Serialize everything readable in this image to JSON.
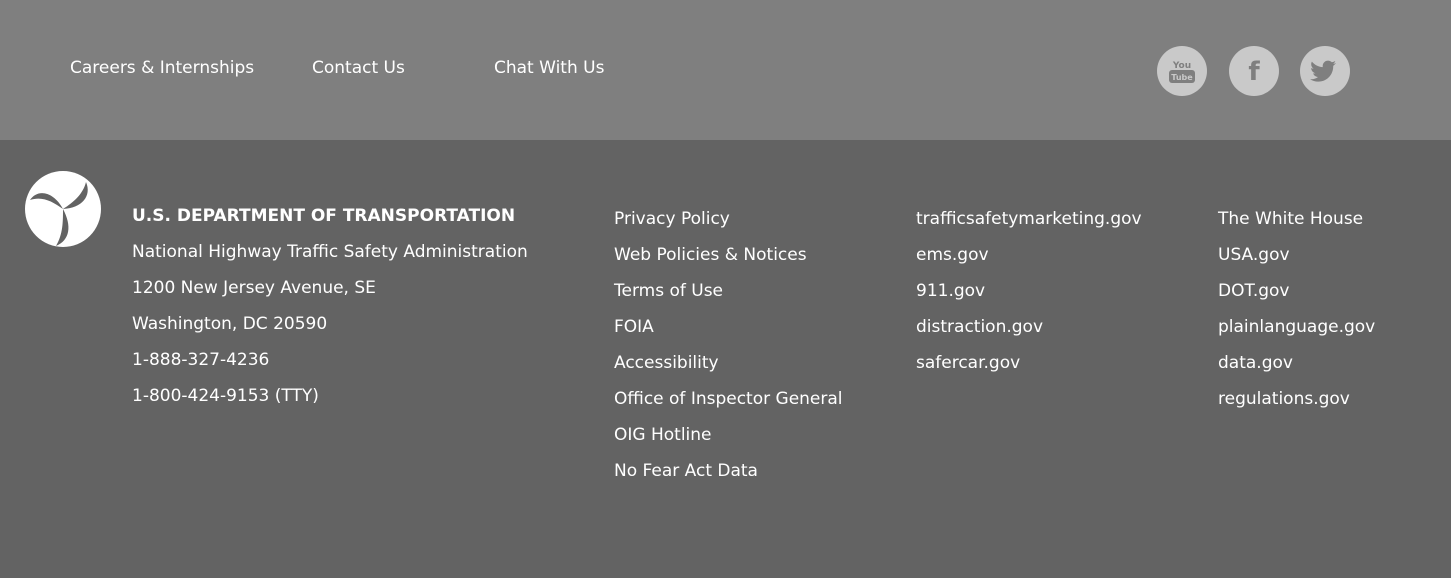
{
  "top_links": [
    {
      "label": "Careers & Internships"
    },
    {
      "label": "Contact Us"
    },
    {
      "label": "Chat With Us"
    }
  ],
  "social": {
    "youtube": {
      "label": "You Tube",
      "line1": "You",
      "line2": "Tube"
    },
    "facebook": {
      "label": "f"
    },
    "twitter": {
      "label": "Twitter"
    }
  },
  "address": {
    "heading": "U.S. DEPARTMENT OF TRANSPORTATION",
    "lines": [
      "National Highway Traffic Safety Administration",
      "1200 New Jersey Avenue, SE",
      "Washington, DC 20590",
      "1-888-327-4236",
      "1-800-424-9153 (TTY)"
    ]
  },
  "policy_links": [
    "Privacy Policy",
    "Web Policies & Notices",
    "Terms of Use",
    "FOIA",
    "Accessibility",
    "Office of Inspector General",
    "OIG Hotline",
    "No Fear Act Data"
  ],
  "site_links": [
    "trafficsafetymarketing.gov",
    "ems.gov",
    "911.gov",
    "distraction.gov",
    "safercar.gov"
  ],
  "gov_links": [
    "The White House",
    "USA.gov",
    "DOT.gov",
    "plainlanguage.gov",
    "data.gov",
    "regulations.gov"
  ],
  "colors": {
    "top_bar": "#7f7f7f",
    "footer_bg": "#636363",
    "social_bg": "#c9c9c9",
    "social_glyph": "#7f7f7f",
    "text": "#ffffff"
  }
}
